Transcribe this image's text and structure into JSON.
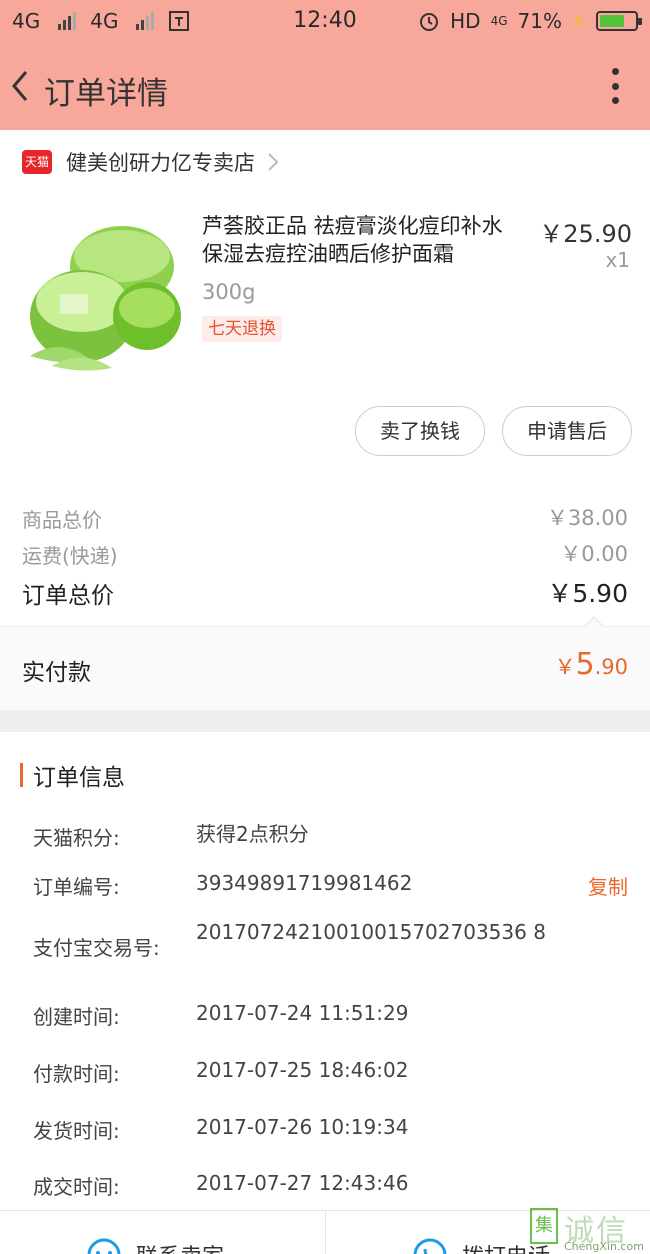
{
  "status_bar": {
    "network1": "4G",
    "network2": "4G",
    "time": "12:40",
    "hd": "HD",
    "net_small": "4G",
    "battery_pct": "71%",
    "battery_level": 0.71,
    "colors": {
      "bg": "#f8a89b",
      "battery_fill": "#52c43b"
    }
  },
  "header": {
    "title": "订单详情"
  },
  "store": {
    "platform_badge": "天猫",
    "name": "健美创研力亿专卖店"
  },
  "product": {
    "title": "芦荟胶正品 祛痘膏淡化痘印补水保湿去痘控油晒后修护面霜",
    "price": "￥25.90",
    "qty": "x1",
    "sku": "300g",
    "tag": "七天退换"
  },
  "actions": {
    "sell": "卖了换钱",
    "after_sale": "申请售后"
  },
  "summary": {
    "goods_label": "商品总价",
    "goods_value": "￥38.00",
    "shipping_label": "运费(快递)",
    "shipping_value": "￥0.00",
    "total_label": "订单总价",
    "total_value": "￥5.90",
    "paid_label": "实付款",
    "paid_yen": "￥",
    "paid_int": "5",
    "paid_dec": ".90",
    "accent": "#e9682c"
  },
  "order_info": {
    "heading": "订单信息",
    "rows": [
      {
        "label": "天猫积分:",
        "value": "获得2点积分"
      },
      {
        "label": "订单编号:",
        "value": "39349891719981462",
        "action": "复制"
      },
      {
        "label": "支付宝交易号:",
        "value": "20170724210010015702703536 8"
      },
      {
        "label": "创建时间:",
        "value": "2017-07-24 11:51:29"
      },
      {
        "label": "付款时间:",
        "value": "2017-07-25 18:46:02"
      },
      {
        "label": "发货时间:",
        "value": "2017-07-26 10:19:34"
      },
      {
        "label": "成交时间:",
        "value": "2017-07-27 12:43:46"
      }
    ]
  },
  "bottom": {
    "contact_seller": "联系卖家",
    "call": "拨打电话"
  },
  "watermark": {
    "box": "集",
    "cn": "诚信",
    "en": "ChengXin.com"
  }
}
